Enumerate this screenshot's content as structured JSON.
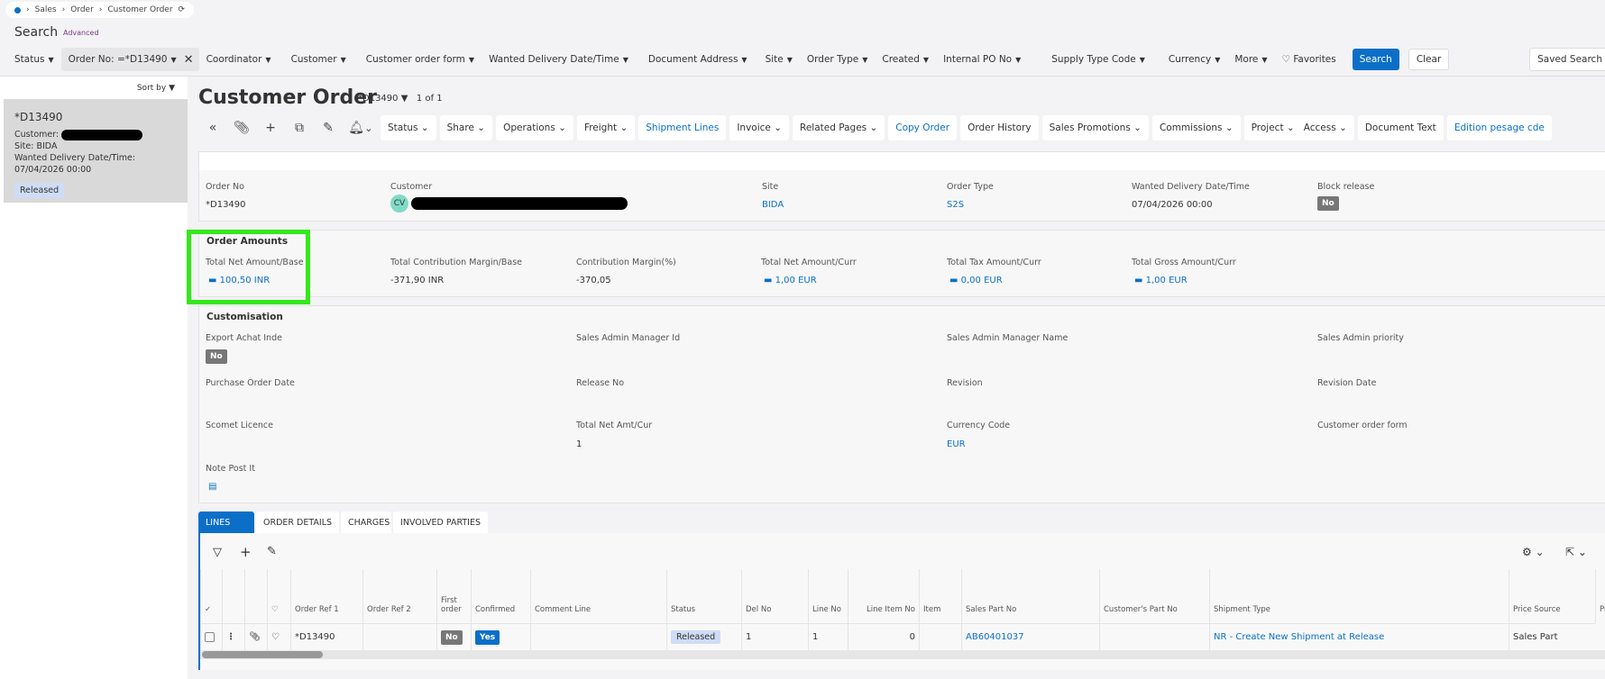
{
  "breadcrumb": [
    "Sales",
    "Order",
    "Customer Order"
  ],
  "search": {
    "title": "Search",
    "advanced": "Advanced"
  },
  "filters": {
    "status": "Status",
    "order_no": "Order No: =*D13490",
    "coordinator": "Coordinator",
    "customer": "Customer",
    "customer_order_form": "Customer order form",
    "wanted": "Wanted Delivery Date/Time",
    "doc_address": "Document Address",
    "site": "Site",
    "order_type": "Order Type",
    "created": "Created",
    "internal_po": "Internal PO No",
    "supply_type": "Supply Type Code",
    "currency": "Currency",
    "more": "More",
    "favorites": "Favorites",
    "search_btn": "Search",
    "clear_btn": "Clear",
    "saved": "Saved Search"
  },
  "list": {
    "sort": "Sort by",
    "id": "*D13490",
    "customer_label": "Customer:",
    "site_label": "Site:",
    "site": "BIDA",
    "wanted_label": "Wanted Delivery Date/Time:",
    "wanted": "07/04/2026 00:00",
    "status": "Released"
  },
  "page": {
    "title": "Customer Order",
    "order": "*D13490",
    "count": "1 of 1"
  },
  "toolbar": [
    "Status",
    "Share",
    "Operations",
    "Freight",
    "Shipment Lines",
    "Invoice",
    "Related Pages",
    "Copy Order",
    "Order History",
    "Sales Promotions",
    "Commissions",
    "Project",
    "Access",
    "Document Text",
    "Edition pesage cde"
  ],
  "header": {
    "order_no_l": "Order No",
    "order_no": "*D13490",
    "customer_l": "Customer",
    "customer_initials": "CV",
    "site_l": "Site",
    "site": "BIDA",
    "type_l": "Order Type",
    "type": "S2S",
    "wanted_l": "Wanted Delivery Date/Time",
    "wanted": "07/04/2026 00:00",
    "block_l": "Block release",
    "block": "No"
  },
  "amounts": {
    "title": "Order Amounts",
    "f": [
      [
        "Total Net Amount/Base",
        "100,50 INR"
      ],
      [
        "Total Contribution Margin/Base",
        "-371,90 INR"
      ],
      [
        "Contribution Margin(%)",
        "-370,05"
      ],
      [
        "Total Net Amount/Curr",
        "1,00 EUR"
      ],
      [
        "Total Tax Amount/Curr",
        "0,00 EUR"
      ],
      [
        "Total Gross Amount/Curr",
        "1,00 EUR"
      ]
    ]
  },
  "custom": {
    "title": "Customisation",
    "export_l": "Export Achat Inde",
    "export": "No",
    "sam_id": "Sales Admin Manager Id",
    "sam_name": "Sales Admin Manager Name",
    "sa_prio": "Sales Admin priority",
    "po_date": "Purchase Order Date",
    "release_no": "Release No",
    "revision": "Revision",
    "revision_date": "Revision Date",
    "scomet": "Scomet Licence",
    "tnac_l": "Total Net Amt/Cur",
    "tnac": "1",
    "cc_l": "Currency Code",
    "cc": "EUR",
    "cof": "Customer order form",
    "note": "Note Post It"
  },
  "tabs": [
    "LINES",
    "ORDER DETAILS",
    "CHARGES",
    "INVOLVED PARTIES"
  ],
  "columns": [
    "Order Ref 1",
    "Order Ref 2",
    "First order",
    "Confirmed",
    "Comment Line",
    "Status",
    "Del No",
    "Line No",
    "Line Item No",
    "Item",
    "Sales Part No",
    "Customer's Part No",
    "Shipment Type",
    "Price Source",
    "Pr"
  ],
  "row": {
    "ref1": "*D13490",
    "first": "No",
    "confirmed": "Yes",
    "status": "Released",
    "del": "1",
    "line": "1",
    "item_no": "0",
    "part": "AB60401037",
    "ship": "NR - Create New Shipment at Release",
    "price": "Sales Part"
  }
}
